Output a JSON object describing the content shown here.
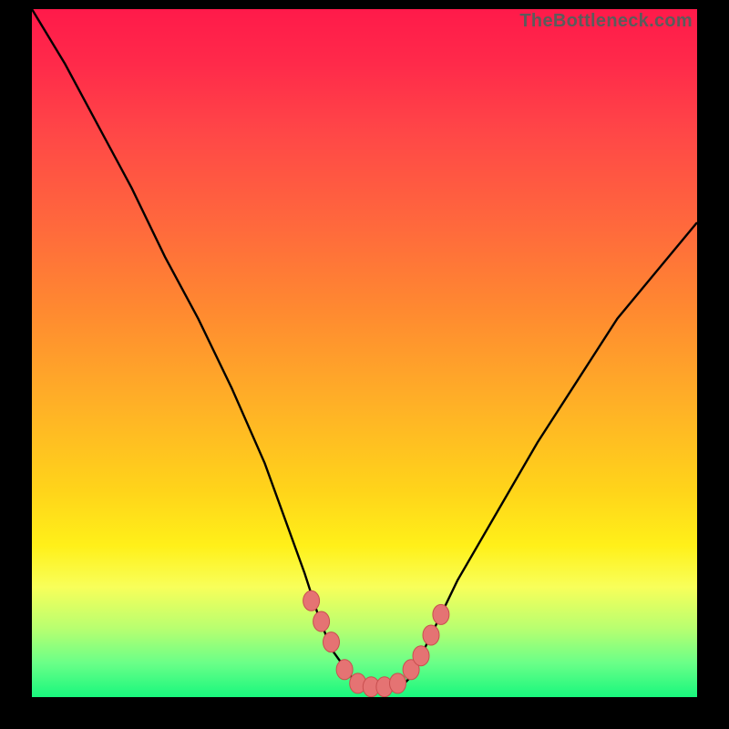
{
  "attribution": "TheBottleneck.com",
  "colors": {
    "frame": "#000000",
    "curve": "#000000",
    "markers_fill": "#e57373",
    "markers_stroke": "#c94f4f",
    "gradient_stops": [
      "#ff1a4a",
      "#ff4747",
      "#ff8a30",
      "#ffd41a",
      "#f8ff5a",
      "#6bff88",
      "#18f77d"
    ]
  },
  "chart_data": {
    "type": "line",
    "title": "",
    "xlabel": "",
    "ylabel": "",
    "xlim": [
      0,
      100
    ],
    "ylim": [
      0,
      100
    ],
    "grid": false,
    "legend": null,
    "series": [
      {
        "name": "bottleneck-curve",
        "x": [
          0,
          5,
          10,
          15,
          20,
          25,
          30,
          35,
          38,
          41,
          43,
          45,
          48,
          52,
          55,
          57,
          59,
          61,
          64,
          70,
          76,
          82,
          88,
          94,
          100
        ],
        "y": [
          100,
          92,
          83,
          74,
          64,
          55,
          45,
          34,
          26,
          18,
          12,
          7,
          3,
          1,
          1,
          3,
          7,
          11,
          17,
          27,
          37,
          46,
          55,
          62,
          69
        ]
      }
    ],
    "markers": {
      "name": "highlight-points",
      "x": [
        42,
        43.5,
        45,
        47,
        49,
        51,
        53,
        55,
        57,
        58.5,
        60,
        61.5
      ],
      "y": [
        14,
        11,
        8,
        4,
        2,
        1.5,
        1.5,
        2,
        4,
        6,
        9,
        12
      ]
    }
  }
}
